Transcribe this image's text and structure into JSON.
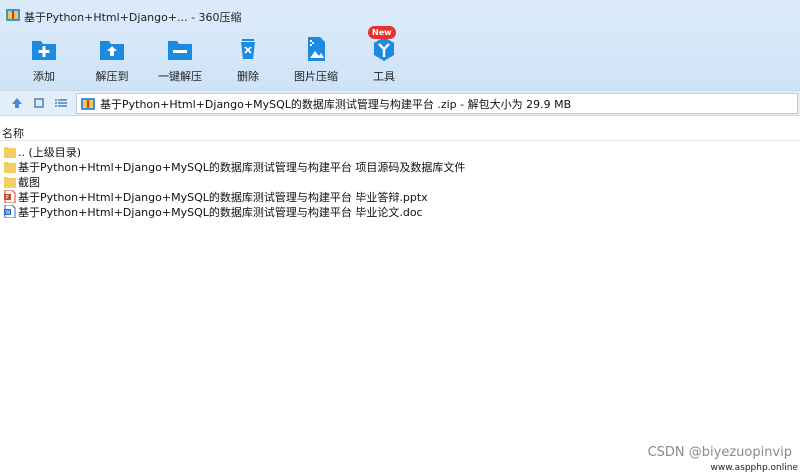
{
  "window": {
    "title": "基于Python+Html+Django+...  - 360压缩"
  },
  "toolbar": {
    "items": [
      {
        "label": "添加",
        "icon": "add-icon"
      },
      {
        "label": "解压到",
        "icon": "extract-to-icon"
      },
      {
        "label": "一键解压",
        "icon": "one-click-extract-icon"
      },
      {
        "label": "删除",
        "icon": "delete-icon"
      },
      {
        "label": "图片压缩",
        "icon": "image-compress-icon"
      },
      {
        "label": "工具",
        "icon": "tools-icon",
        "badge": "New"
      }
    ]
  },
  "navbar": {
    "path": "基于Python+Html+Django+MySQL的数据库测试管理与构建平台 .zip - 解包大小为 29.9 MB"
  },
  "file_list": {
    "column_header": "名称",
    "rows": [
      {
        "name": ".. (上级目录)",
        "type": "folder"
      },
      {
        "name": "基于Python+Html+Django+MySQL的数据库测试管理与构建平台 项目源码及数据库文件",
        "type": "folder"
      },
      {
        "name": "截图",
        "type": "folder"
      },
      {
        "name": "基于Python+Html+Django+MySQL的数据库测试管理与构建平台 毕业答辩.pptx",
        "type": "pptx"
      },
      {
        "name": "基于Python+Html+Django+MySQL的数据库测试管理与构建平台 毕业论文.doc",
        "type": "doc"
      }
    ]
  },
  "watermark": {
    "csdn": "CSDN @biyezuopinvip",
    "site": "www.aspphp.online"
  },
  "colors": {
    "accent": "#1a8be0",
    "badge": "#e8322a",
    "folder": "#f3cf63"
  }
}
